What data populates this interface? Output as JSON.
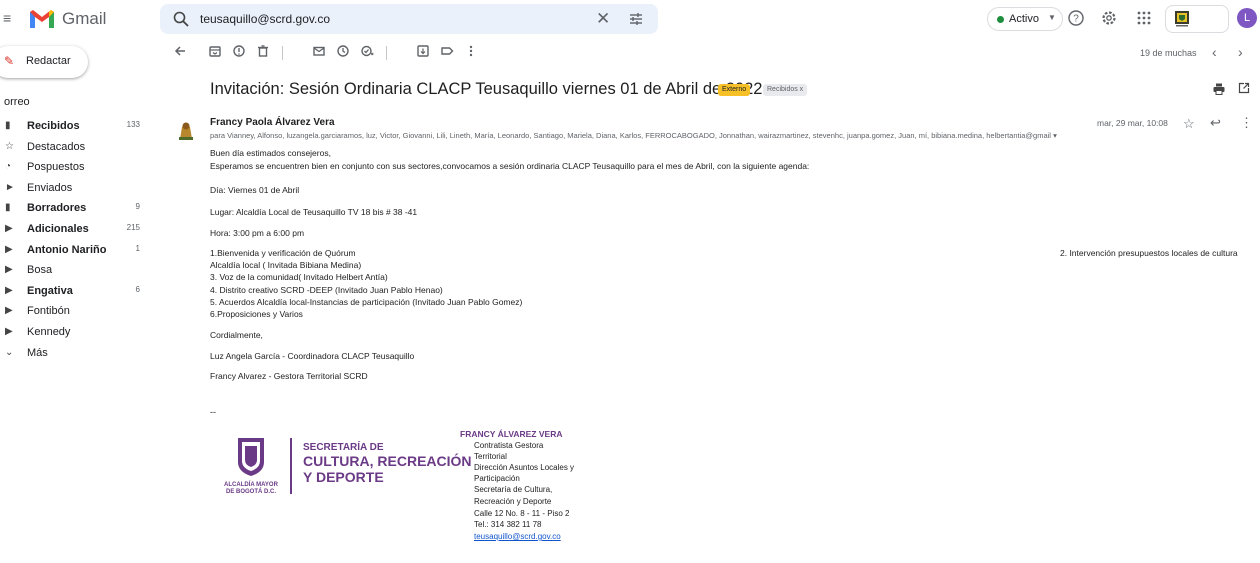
{
  "header": {
    "app_name": "Gmail",
    "search_value": "teusaquillo@scrd.gov.co",
    "status_label": "Activo",
    "avatar_initial": "L"
  },
  "sidebar": {
    "compose_label": "Redactar",
    "section_label": "orreo",
    "items": [
      {
        "label": "Recibidos",
        "count": "133",
        "bold": true
      },
      {
        "label": "Destacados",
        "count": "",
        "bold": false
      },
      {
        "label": "Pospuestos",
        "count": "",
        "bold": false
      },
      {
        "label": "Enviados",
        "count": "",
        "bold": false
      },
      {
        "label": "Borradores",
        "count": "9",
        "bold": true
      },
      {
        "label": "Adicionales",
        "count": "215",
        "bold": true
      },
      {
        "label": "Antonio Nariño",
        "count": "1",
        "bold": true
      },
      {
        "label": "Bosa",
        "count": "",
        "bold": false
      },
      {
        "label": "Engativa",
        "count": "6",
        "bold": true
      },
      {
        "label": "Fontibón",
        "count": "",
        "bold": false
      },
      {
        "label": "Kennedy",
        "count": "",
        "bold": false
      },
      {
        "label": "Más",
        "count": "",
        "bold": false
      }
    ]
  },
  "toolbar": {
    "pager": "19 de muchas"
  },
  "email": {
    "subject": "Invitación: Sesión Ordinaria CLACP Teusaquillo viernes 01 de Abril de 2022",
    "badge_external": "Externo",
    "badge_inbox": "Recibidos x",
    "sender": "Francy Paola Álvarez Vera",
    "recipients": "para Vianney, Alfonso, luzangela.garciaramos, luz, Victor, Giovanni, Lili, Lineth, María, Leonardo, Santiago, Mariela, Diana, Karlos, FERROCABOGADO, Jonnathan, wairazmartinez, stevenhc, juanpa.gomez, Juan, mí, bibiana.medina, helbertantia@gmail",
    "date": "mar, 29 mar, 10:08",
    "greeting": "Buen día estimados consejeros,",
    "intro": "Esperamos se encuentren bien en conjunto con sus sectores,convocamos a sesión ordinaria CLACP Teusaquillo para el mes de Abril, con la siguiente agenda:",
    "day": "Día: Viernes 01 de Abril",
    "place": "Lugar: Alcaldía Local de Teusaquillo  TV 18 bis # 38 -41",
    "time": "Hora: 3:00 pm a 6:00 pm",
    "agenda": [
      "1.Bienvenida y verificación de Quórum",
      "Alcaldía local ( Invitada Bibiana Medina)",
      "3. Voz de la comunidad( Invitado Helbert Antía)",
      "4. Distrito creativo SCRD -DEEP (Invitado Juan Pablo Henao)",
      "5. Acuerdos Alcaldía local-Instancias de participación (Invitado Juan Pablo Gomez)",
      "6.Proposiciones y Varios"
    ],
    "agenda_right": "2. Intervención presupuestos locales de cultura",
    "closing": "Cordialmente,",
    "sign1": "Luz Angela García - Coordinadora CLACP Teusaquillo",
    "sign2": "Francy Alvarez - Gestora Territorial SCRD"
  },
  "signature": {
    "dash": "--",
    "logo_caption": [
      "ALCALDÍA MAYOR",
      "DE BOGOTÁ D.C."
    ],
    "org_lines": [
      "SECRETARÍA DE",
      "CULTURA, RECREACIÓN",
      "Y DEPORTE"
    ],
    "name": "FRANCY ÁLVAREZ VERA",
    "lines": [
      "Contratista Gestora",
      "Territorial",
      "Dirección Asuntos Locales y",
      "Participación",
      "Secretaría de Cultura,",
      "Recreación y Deporte",
      "Calle 12 No. 8 - 11 -  Piso 2",
      "Tel.: 314 382 11 78"
    ],
    "email": "teusaquillo@scrd.gov.co"
  }
}
